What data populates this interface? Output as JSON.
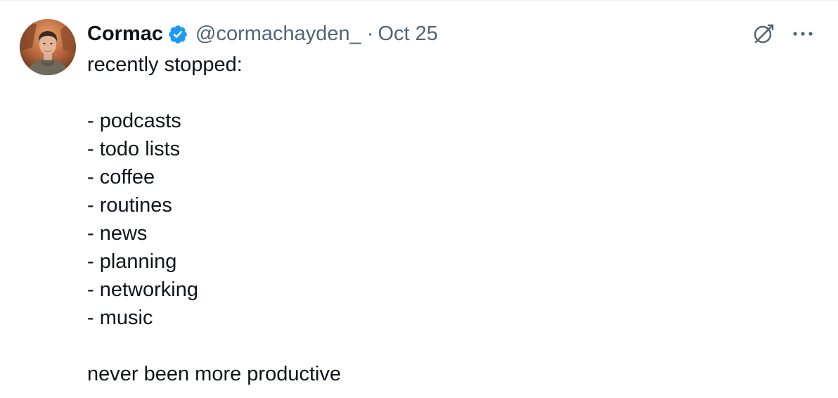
{
  "tweet": {
    "author": {
      "display_name": "Cormac",
      "verified": true,
      "handle": "@cormachayden_",
      "separator": "·",
      "date": "Oct 25",
      "avatar_icon": "avatar-photo"
    },
    "actions": {
      "grok_icon": "grok-icon",
      "more_icon": "more-icon"
    },
    "text": {
      "intro": "recently stopped:",
      "items": [
        "- podcasts",
        "- todo lists",
        "- coffee",
        "- routines",
        "- news",
        "- planning",
        "- networking",
        "- music"
      ],
      "closing": "never been more productive"
    }
  },
  "colors": {
    "primary_text": "#0f1419",
    "secondary_text": "#536471",
    "verified_blue": "#1d9bf0",
    "divider": "#eff3f4"
  }
}
